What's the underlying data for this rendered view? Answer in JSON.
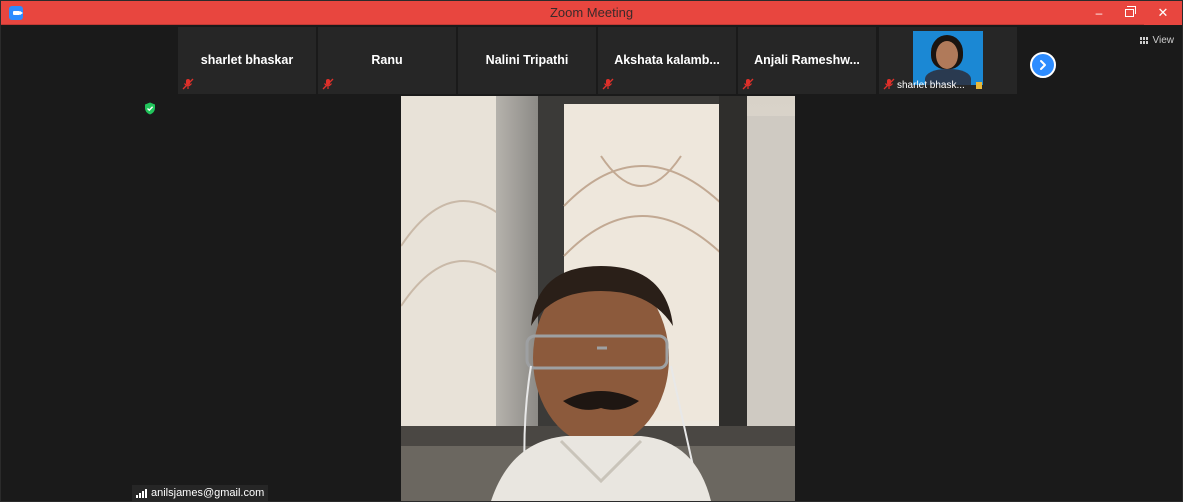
{
  "window": {
    "title": "Zoom Meeting",
    "controls": {
      "minimize": "–",
      "close": "✕"
    }
  },
  "participants": [
    {
      "name": "sharlet bhaskar",
      "muted": true
    },
    {
      "name": "Ranu",
      "muted": true
    },
    {
      "name": "Nalini Tripathi",
      "muted": true
    },
    {
      "name": "Akshata  kalamb...",
      "muted": true
    },
    {
      "name": "Anjali  Rameshw...",
      "muted": true
    }
  ],
  "video_tile": {
    "caption": "sharlet bhask...",
    "muted": true
  },
  "view_button": {
    "label": "View"
  },
  "speaker": {
    "label": "anilsjames@gmail.com"
  },
  "colors": {
    "titlebar": "#e8463f",
    "background": "#1a1a1a",
    "tile": "#262626",
    "accent": "#2d8cff",
    "shield": "#21c45b",
    "mute": "#e0302a"
  },
  "icons": [
    "zoom-app-icon",
    "minimize-icon",
    "maximize-icon",
    "close-icon",
    "muted-mic-icon",
    "next-page-icon",
    "gallery-view-icon",
    "security-shield-icon",
    "signal-bars-icon"
  ]
}
